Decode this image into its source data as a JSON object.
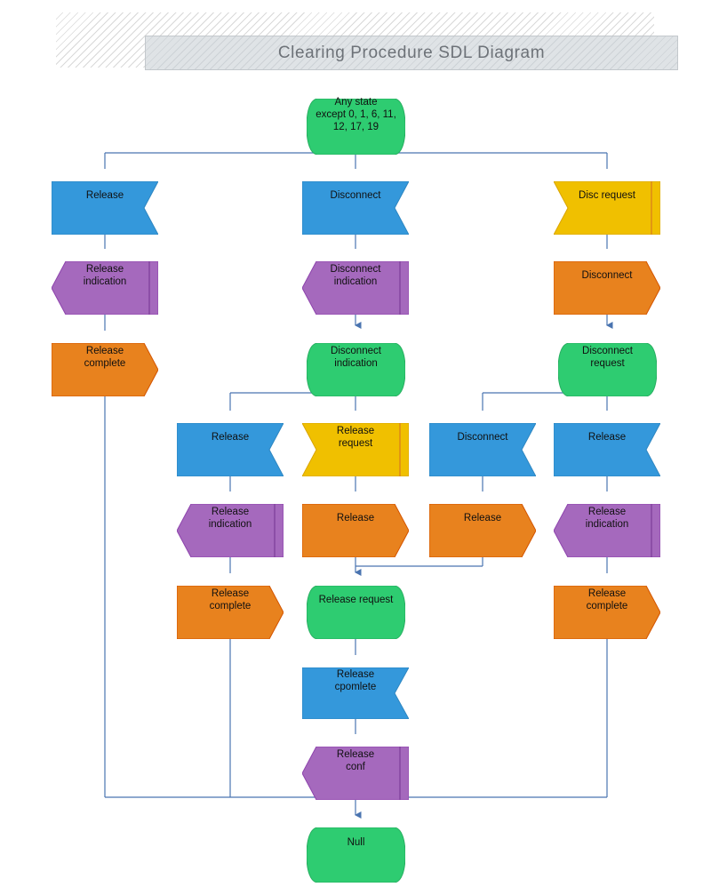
{
  "title": {
    "text": "Clearing Procedure SDL Diagram"
  },
  "colors": {
    "state_green": "#2ecc71",
    "input_blue": "#3498db",
    "save_purple": "#a569bd",
    "output_orange": "#e8821e",
    "priority_yellow": "#f0c000",
    "connector_blue": "#4a74b0",
    "shape_stroke_green": "#27ae60",
    "shape_stroke_blue": "#2e86c1",
    "shape_stroke_purple": "#8e44ad",
    "shape_stroke_orange": "#d35400",
    "shape_stroke_yellow": "#d9a400",
    "title_text": "#6d7278"
  },
  "chart_data": {
    "type": "diagram",
    "diagram_kind": "SDL state diagram",
    "title": "Clearing Procedure SDL Diagram",
    "legend_shapes": [
      {
        "shape": "state",
        "geometry": "rounded-side rectangle",
        "color": "#2ecc71"
      },
      {
        "shape": "input",
        "geometry": "rectangle with notch on right edge",
        "color": "#3498db"
      },
      {
        "shape": "save",
        "geometry": "pentagon pointing left with right bar",
        "color": "#a569bd"
      },
      {
        "shape": "output",
        "geometry": "rectangle with point on right edge",
        "color": "#e8821e"
      },
      {
        "shape": "priority-input",
        "geometry": "rectangle with notch on left edge and right bar",
        "color": "#f0c000"
      }
    ],
    "nodes": [
      {
        "id": "n1",
        "label": "Any state\nexcept 0, 1, 6, 11,\n12, 17, 19",
        "shape": "state",
        "color": "#2ecc71"
      },
      {
        "id": "n2",
        "label": "Release",
        "shape": "input",
        "color": "#3498db"
      },
      {
        "id": "n3",
        "label": "Disconnect",
        "shape": "input",
        "color": "#3498db"
      },
      {
        "id": "n4",
        "label": "Disc request",
        "shape": "priority-input",
        "color": "#f0c000"
      },
      {
        "id": "n5",
        "label": "Release\nindication",
        "shape": "save",
        "color": "#a569bd"
      },
      {
        "id": "n6",
        "label": "Disconnect\nindication",
        "shape": "save",
        "color": "#a569bd"
      },
      {
        "id": "n7",
        "label": "Disconnect",
        "shape": "output",
        "color": "#e8821e"
      },
      {
        "id": "n8",
        "label": "Release\ncomplete",
        "shape": "output",
        "color": "#e8821e"
      },
      {
        "id": "n9",
        "label": "Disconnect\nindication",
        "shape": "state",
        "color": "#2ecc71"
      },
      {
        "id": "n10",
        "label": "Disconnect\nrequest",
        "shape": "state",
        "color": "#2ecc71"
      },
      {
        "id": "n11",
        "label": "Release",
        "shape": "input",
        "color": "#3498db"
      },
      {
        "id": "n12",
        "label": "Release\nrequest",
        "shape": "priority-input",
        "color": "#f0c000"
      },
      {
        "id": "n13",
        "label": "Disconnect",
        "shape": "input",
        "color": "#3498db"
      },
      {
        "id": "n14",
        "label": "Release",
        "shape": "input",
        "color": "#3498db"
      },
      {
        "id": "n15",
        "label": "Release\nindication",
        "shape": "save",
        "color": "#a569bd"
      },
      {
        "id": "n16",
        "label": "Release",
        "shape": "output",
        "color": "#e8821e"
      },
      {
        "id": "n17",
        "label": "Release",
        "shape": "output",
        "color": "#e8821e"
      },
      {
        "id": "n18",
        "label": "Release\nindication",
        "shape": "save",
        "color": "#a569bd"
      },
      {
        "id": "n19",
        "label": "Release\ncomplete",
        "shape": "output",
        "color": "#e8821e"
      },
      {
        "id": "n20",
        "label": "Release request",
        "shape": "state",
        "color": "#2ecc71"
      },
      {
        "id": "n21",
        "label": "Release\ncomplete",
        "shape": "output",
        "color": "#e8821e"
      },
      {
        "id": "n22",
        "label": "Release\ncpomlete",
        "shape": "input",
        "color": "#3498db"
      },
      {
        "id": "n23",
        "label": "Release\nconf",
        "shape": "save",
        "color": "#a569bd"
      },
      {
        "id": "n24",
        "label": "Null",
        "shape": "state",
        "color": "#2ecc71"
      }
    ],
    "edges": [
      {
        "from": "n1",
        "to": "n2"
      },
      {
        "from": "n1",
        "to": "n3"
      },
      {
        "from": "n1",
        "to": "n4"
      },
      {
        "from": "n2",
        "to": "n5"
      },
      {
        "from": "n5",
        "to": "n8"
      },
      {
        "from": "n3",
        "to": "n6"
      },
      {
        "from": "n6",
        "to": "n9"
      },
      {
        "from": "n4",
        "to": "n7"
      },
      {
        "from": "n7",
        "to": "n10"
      },
      {
        "from": "n9",
        "to": "n11"
      },
      {
        "from": "n9",
        "to": "n12"
      },
      {
        "from": "n10",
        "to": "n13"
      },
      {
        "from": "n10",
        "to": "n14"
      },
      {
        "from": "n11",
        "to": "n15"
      },
      {
        "from": "n15",
        "to": "n21"
      },
      {
        "from": "n12",
        "to": "n16"
      },
      {
        "from": "n16",
        "to": "n20"
      },
      {
        "from": "n13",
        "to": "n17"
      },
      {
        "from": "n17",
        "to": "n20"
      },
      {
        "from": "n14",
        "to": "n18"
      },
      {
        "from": "n18",
        "to": "n19"
      },
      {
        "from": "n20",
        "to": "n22"
      },
      {
        "from": "n22",
        "to": "n23"
      },
      {
        "from": "n23",
        "to": "n24"
      },
      {
        "from": "n8",
        "to": "n24"
      },
      {
        "from": "n21",
        "to": "n24"
      },
      {
        "from": "n19",
        "to": "n24"
      }
    ]
  },
  "nodes": {
    "n1": {
      "label": "Any state\nexcept 0, 1, 6, 11,\n12, 17, 19"
    },
    "n2": {
      "label": "Release"
    },
    "n3": {
      "label": "Disconnect"
    },
    "n4": {
      "label": "Disc request"
    },
    "n5": {
      "label": "Release\nindication"
    },
    "n6": {
      "label": "Disconnect\nindication"
    },
    "n7": {
      "label": "Disconnect"
    },
    "n8": {
      "label": "Release\ncomplete"
    },
    "n9": {
      "label": "Disconnect\nindication"
    },
    "n10": {
      "label": "Disconnect\nrequest"
    },
    "n11": {
      "label": "Release"
    },
    "n12": {
      "label": "Release\nrequest"
    },
    "n13": {
      "label": "Disconnect"
    },
    "n14": {
      "label": "Release"
    },
    "n15": {
      "label": "Release\nindication"
    },
    "n16": {
      "label": "Release"
    },
    "n17": {
      "label": "Release"
    },
    "n18": {
      "label": "Release\nindication"
    },
    "n19": {
      "label": "Release\ncomplete"
    },
    "n20": {
      "label": "Release request"
    },
    "n21": {
      "label": "Release\ncomplete"
    },
    "n22": {
      "label": "Release\ncpomlete"
    },
    "n23": {
      "label": "Release\nconf"
    },
    "n24": {
      "label": "Null"
    }
  }
}
